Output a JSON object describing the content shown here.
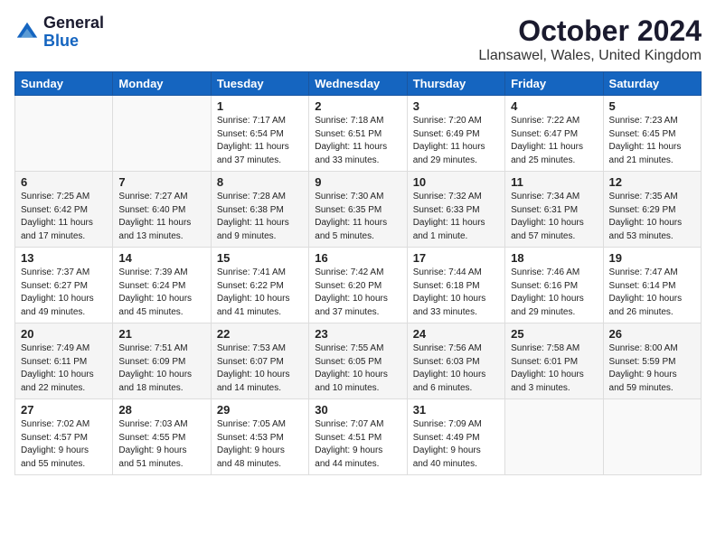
{
  "header": {
    "logo": {
      "general": "General",
      "blue": "Blue"
    },
    "title": "October 2024",
    "location": "Llansawel, Wales, United Kingdom"
  },
  "weekdays": [
    "Sunday",
    "Monday",
    "Tuesday",
    "Wednesday",
    "Thursday",
    "Friday",
    "Saturday"
  ],
  "weeks": [
    [
      {
        "day": "",
        "info": ""
      },
      {
        "day": "",
        "info": ""
      },
      {
        "day": "1",
        "info": "Sunrise: 7:17 AM\nSunset: 6:54 PM\nDaylight: 11 hours\nand 37 minutes."
      },
      {
        "day": "2",
        "info": "Sunrise: 7:18 AM\nSunset: 6:51 PM\nDaylight: 11 hours\nand 33 minutes."
      },
      {
        "day": "3",
        "info": "Sunrise: 7:20 AM\nSunset: 6:49 PM\nDaylight: 11 hours\nand 29 minutes."
      },
      {
        "day": "4",
        "info": "Sunrise: 7:22 AM\nSunset: 6:47 PM\nDaylight: 11 hours\nand 25 minutes."
      },
      {
        "day": "5",
        "info": "Sunrise: 7:23 AM\nSunset: 6:45 PM\nDaylight: 11 hours\nand 21 minutes."
      }
    ],
    [
      {
        "day": "6",
        "info": "Sunrise: 7:25 AM\nSunset: 6:42 PM\nDaylight: 11 hours\nand 17 minutes."
      },
      {
        "day": "7",
        "info": "Sunrise: 7:27 AM\nSunset: 6:40 PM\nDaylight: 11 hours\nand 13 minutes."
      },
      {
        "day": "8",
        "info": "Sunrise: 7:28 AM\nSunset: 6:38 PM\nDaylight: 11 hours\nand 9 minutes."
      },
      {
        "day": "9",
        "info": "Sunrise: 7:30 AM\nSunset: 6:35 PM\nDaylight: 11 hours\nand 5 minutes."
      },
      {
        "day": "10",
        "info": "Sunrise: 7:32 AM\nSunset: 6:33 PM\nDaylight: 11 hours\nand 1 minute."
      },
      {
        "day": "11",
        "info": "Sunrise: 7:34 AM\nSunset: 6:31 PM\nDaylight: 10 hours\nand 57 minutes."
      },
      {
        "day": "12",
        "info": "Sunrise: 7:35 AM\nSunset: 6:29 PM\nDaylight: 10 hours\nand 53 minutes."
      }
    ],
    [
      {
        "day": "13",
        "info": "Sunrise: 7:37 AM\nSunset: 6:27 PM\nDaylight: 10 hours\nand 49 minutes."
      },
      {
        "day": "14",
        "info": "Sunrise: 7:39 AM\nSunset: 6:24 PM\nDaylight: 10 hours\nand 45 minutes."
      },
      {
        "day": "15",
        "info": "Sunrise: 7:41 AM\nSunset: 6:22 PM\nDaylight: 10 hours\nand 41 minutes."
      },
      {
        "day": "16",
        "info": "Sunrise: 7:42 AM\nSunset: 6:20 PM\nDaylight: 10 hours\nand 37 minutes."
      },
      {
        "day": "17",
        "info": "Sunrise: 7:44 AM\nSunset: 6:18 PM\nDaylight: 10 hours\nand 33 minutes."
      },
      {
        "day": "18",
        "info": "Sunrise: 7:46 AM\nSunset: 6:16 PM\nDaylight: 10 hours\nand 29 minutes."
      },
      {
        "day": "19",
        "info": "Sunrise: 7:47 AM\nSunset: 6:14 PM\nDaylight: 10 hours\nand 26 minutes."
      }
    ],
    [
      {
        "day": "20",
        "info": "Sunrise: 7:49 AM\nSunset: 6:11 PM\nDaylight: 10 hours\nand 22 minutes."
      },
      {
        "day": "21",
        "info": "Sunrise: 7:51 AM\nSunset: 6:09 PM\nDaylight: 10 hours\nand 18 minutes."
      },
      {
        "day": "22",
        "info": "Sunrise: 7:53 AM\nSunset: 6:07 PM\nDaylight: 10 hours\nand 14 minutes."
      },
      {
        "day": "23",
        "info": "Sunrise: 7:55 AM\nSunset: 6:05 PM\nDaylight: 10 hours\nand 10 minutes."
      },
      {
        "day": "24",
        "info": "Sunrise: 7:56 AM\nSunset: 6:03 PM\nDaylight: 10 hours\nand 6 minutes."
      },
      {
        "day": "25",
        "info": "Sunrise: 7:58 AM\nSunset: 6:01 PM\nDaylight: 10 hours\nand 3 minutes."
      },
      {
        "day": "26",
        "info": "Sunrise: 8:00 AM\nSunset: 5:59 PM\nDaylight: 9 hours\nand 59 minutes."
      }
    ],
    [
      {
        "day": "27",
        "info": "Sunrise: 7:02 AM\nSunset: 4:57 PM\nDaylight: 9 hours\nand 55 minutes."
      },
      {
        "day": "28",
        "info": "Sunrise: 7:03 AM\nSunset: 4:55 PM\nDaylight: 9 hours\nand 51 minutes."
      },
      {
        "day": "29",
        "info": "Sunrise: 7:05 AM\nSunset: 4:53 PM\nDaylight: 9 hours\nand 48 minutes."
      },
      {
        "day": "30",
        "info": "Sunrise: 7:07 AM\nSunset: 4:51 PM\nDaylight: 9 hours\nand 44 minutes."
      },
      {
        "day": "31",
        "info": "Sunrise: 7:09 AM\nSunset: 4:49 PM\nDaylight: 9 hours\nand 40 minutes."
      },
      {
        "day": "",
        "info": ""
      },
      {
        "day": "",
        "info": ""
      }
    ]
  ]
}
